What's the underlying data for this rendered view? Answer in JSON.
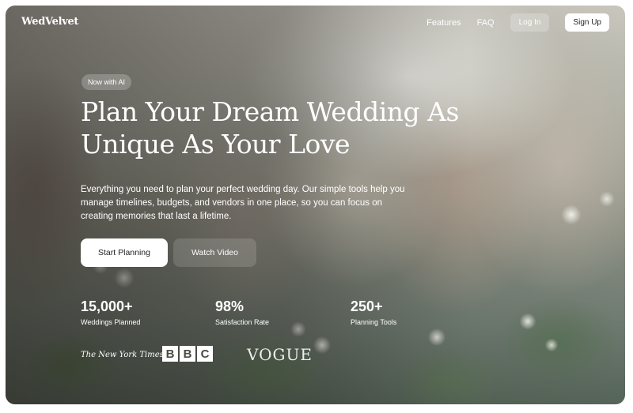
{
  "header": {
    "logo": "WedVelvet",
    "nav": [
      "Features",
      "FAQ"
    ],
    "login_label": "Log In",
    "signup_label": "Sign Up"
  },
  "hero": {
    "badge": "Now with AI",
    "headline_line1": "Plan Your Dream Wedding As",
    "headline_line2": "Unique As Your Love",
    "subtext": "Everything you need to plan your perfect wedding day. Our simple tools help you manage timelines, budgets, and vendors in one place, so you can focus on creating memories that last a lifetime.",
    "primary_cta": "Start Planning",
    "secondary_cta": "Watch Video"
  },
  "stats": [
    {
      "value": "15,000+",
      "label": "Weddings Planned"
    },
    {
      "value": "98%",
      "label": "Satisfaction Rate"
    },
    {
      "value": "250+",
      "label": "Planning Tools"
    }
  ],
  "press": {
    "nyt": "The New York Times",
    "bbc": [
      "B",
      "B",
      "C"
    ],
    "vogue": "VOGUE"
  }
}
